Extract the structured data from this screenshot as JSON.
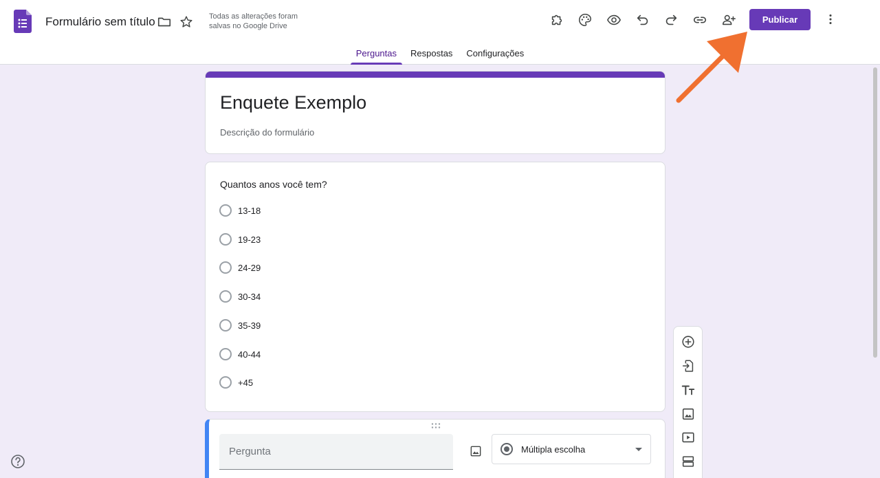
{
  "header": {
    "doc_title": "Formulário sem título",
    "save_status": "Todas as alterações foram salvas no Google Drive",
    "publish_label": "Publicar",
    "icons": [
      "forms-logo-icon",
      "folder-icon",
      "star-icon",
      "addons-icon",
      "palette-icon",
      "preview-eye-icon",
      "undo-icon",
      "redo-icon",
      "link-icon",
      "add-collaborator-icon",
      "more-vert-icon"
    ]
  },
  "tabs": [
    {
      "label": "Perguntas",
      "active": true
    },
    {
      "label": "Respostas",
      "active": false
    },
    {
      "label": "Configurações",
      "active": false
    }
  ],
  "form": {
    "title": "Enquete Exemplo",
    "description": "Descrição do formulário"
  },
  "question": {
    "title": "Quantos anos você tem?",
    "options": [
      "13-18",
      "19-23",
      "24-29",
      "30-34",
      "35-39",
      "40-44",
      "+45"
    ]
  },
  "editor": {
    "question_placeholder": "Pergunta",
    "type_label": "Múltipla escolha"
  },
  "toolbar": {
    "tools": [
      "add-question-icon",
      "import-questions-icon",
      "add-title-icon",
      "add-image-icon",
      "add-video-icon",
      "add-section-icon"
    ]
  },
  "colors": {
    "accent": "#673ab7",
    "background": "#f0ebf8",
    "edit_highlight": "#4285f4",
    "annotation_arrow": "#f07030"
  }
}
